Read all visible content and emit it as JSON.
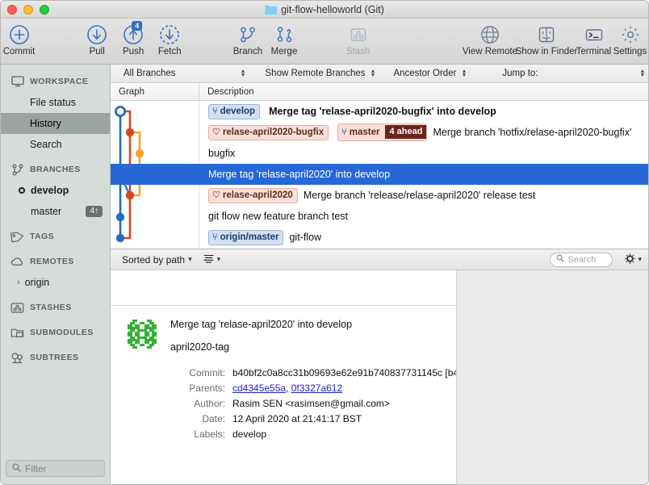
{
  "window": {
    "title": "git-flow-helloworld (Git)",
    "folder_icon": "folder-icon"
  },
  "toolbar": {
    "items": [
      {
        "label": "Commit",
        "icon": "commit-plus-icon",
        "disabled": false,
        "badge": null
      },
      {
        "label": "Pull",
        "icon": "pull-down-arrow-icon",
        "disabled": false,
        "badge": null
      },
      {
        "label": "Push",
        "icon": "push-up-arrow-icon",
        "disabled": false,
        "badge": "4"
      },
      {
        "label": "Fetch",
        "icon": "fetch-dashed-arrow-icon",
        "disabled": false,
        "badge": null
      },
      {
        "label": "Branch",
        "icon": "branch-icon",
        "disabled": false,
        "badge": null
      },
      {
        "label": "Merge",
        "icon": "merge-icon",
        "disabled": false,
        "badge": null
      },
      {
        "label": "Stash",
        "icon": "stash-icon",
        "disabled": true,
        "badge": null
      },
      {
        "label": "View Remote",
        "icon": "globe-icon",
        "disabled": false,
        "badge": null
      },
      {
        "label": "Show in Finder",
        "icon": "finder-icon",
        "disabled": false,
        "badge": null
      },
      {
        "label": "Terminal",
        "icon": "terminal-icon",
        "disabled": false,
        "badge": null
      },
      {
        "label": "Settings",
        "icon": "gear-icon",
        "disabled": false,
        "badge": null
      }
    ]
  },
  "sidebar": {
    "workspace": {
      "label": "WORKSPACE",
      "icon": "monitor-icon"
    },
    "workspace_items": [
      {
        "label": "File status",
        "selected": false
      },
      {
        "label": "History",
        "selected": true
      },
      {
        "label": "Search",
        "selected": false
      }
    ],
    "branches": {
      "label": "BRANCHES",
      "icon": "branch-icon"
    },
    "branch_items": [
      {
        "label": "develop",
        "current": true,
        "ahead": null
      },
      {
        "label": "master",
        "current": false,
        "ahead": "4↑"
      }
    ],
    "tags": {
      "label": "TAGS",
      "icon": "tag-icon"
    },
    "remotes": {
      "label": "REMOTES",
      "icon": "cloud-icon"
    },
    "remote_items": [
      {
        "label": "origin",
        "chevron": "›"
      }
    ],
    "stashes": {
      "label": "STASHES",
      "icon": "stash-icon"
    },
    "submodules": {
      "label": "SUBMODULES",
      "icon": "submodule-icon"
    },
    "subtrees": {
      "label": "SUBTREES",
      "icon": "subtree-icon"
    },
    "filter": {
      "placeholder": "Filter",
      "icon": "search-icon",
      "value": ""
    }
  },
  "filterbar": {
    "branch_scope": "All Branches",
    "remote_branches": "Show Remote Branches",
    "order": "Ancestor Order",
    "jump_to": "Jump to:"
  },
  "columns": {
    "graph": "Graph",
    "description": "Description"
  },
  "commits": [
    {
      "labels": [
        {
          "text": "develop",
          "kind": "branch",
          "style": "blue"
        }
      ],
      "message": "Merge tag 'relase-april2020-bugfix' into develop",
      "bold": true,
      "selected": false
    },
    {
      "labels": [
        {
          "text": "relase-april2020-bugfix",
          "kind": "tag",
          "style": "pink"
        },
        {
          "text": "master",
          "kind": "branch",
          "style": "pink",
          "ahead": "4 ahead"
        }
      ],
      "message": "Merge branch 'hotfix/relase-april2020-bugfix'",
      "bold": false,
      "selected": false
    },
    {
      "labels": [],
      "message": "bugfix",
      "bold": false,
      "selected": false
    },
    {
      "labels": [],
      "message": "Merge tag 'relase-april2020' into develop",
      "bold": false,
      "selected": true
    },
    {
      "labels": [
        {
          "text": "relase-april2020",
          "kind": "tag",
          "style": "pink"
        }
      ],
      "message": "Merge branch 'release/relase-april2020' release test",
      "bold": false,
      "selected": false
    },
    {
      "labels": [],
      "message": "git flow new feature branch test",
      "bold": false,
      "selected": false
    },
    {
      "labels": [
        {
          "text": "origin/master",
          "kind": "branch",
          "style": "blue"
        }
      ],
      "message": "git-flow",
      "bold": false,
      "selected": false
    }
  ],
  "detailbar": {
    "sort": "Sorted by path",
    "view_icon": "list-view-icon",
    "search": {
      "placeholder": "Search",
      "value": "",
      "icon": "search-icon"
    },
    "gear": "gear-icon"
  },
  "commit_detail": {
    "avatar": "identicon-avatar",
    "subject": "Merge tag 'relase-april2020' into develop",
    "description": "april2020-tag",
    "fields": [
      {
        "key": "Commit:",
        "value": "b40bf2c0a8cc31b09693e62e91b740837731145c [b4",
        "links": []
      },
      {
        "key": "Parents:",
        "value": "",
        "links": [
          "cd4345e55a",
          "0f3327a612"
        ]
      },
      {
        "key": "Author:",
        "value": "Rasim SEN <rasimsen@gmail.com>",
        "links": []
      },
      {
        "key": "Date:",
        "value": "12 April 2020 at 21:41:17 BST",
        "links": []
      },
      {
        "key": "Labels:",
        "value": "develop",
        "links": []
      }
    ]
  },
  "colors": {
    "accent_blue": "#2767d6",
    "graph_blue": "#1f6ec4",
    "graph_red": "#d4471f",
    "graph_orange": "#f8a22e",
    "selection": "#2767d6"
  }
}
